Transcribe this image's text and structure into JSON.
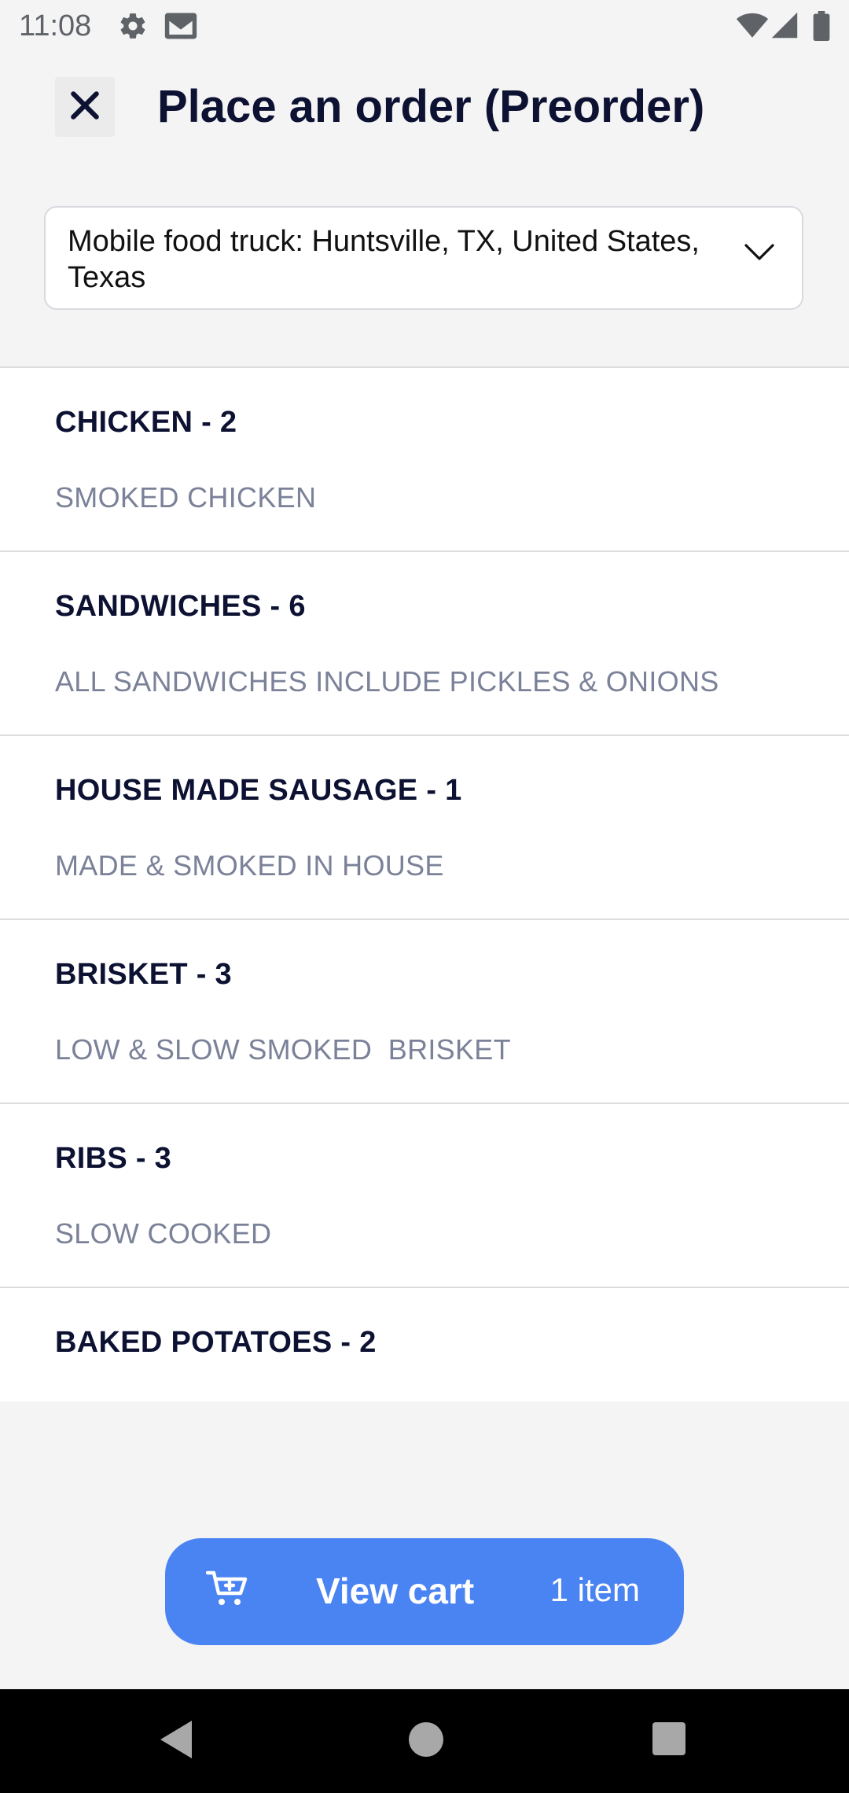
{
  "status_bar": {
    "time": "11:08",
    "icons": [
      "settings-icon",
      "gmail-icon",
      "wifi-icon",
      "signal-icon",
      "battery-icon"
    ]
  },
  "header": {
    "close_icon": "close-icon",
    "title": "Place an order (Preorder)"
  },
  "location": {
    "value": "Mobile food truck: Huntsville, TX, United States, Texas",
    "icon": "chevron-down-icon"
  },
  "categories": [
    {
      "title": "CHICKEN - 2",
      "description": "SMOKED CHICKEN"
    },
    {
      "title": "SANDWICHES - 6",
      "description": "ALL SANDWICHES INCLUDE PICKLES & ONIONS"
    },
    {
      "title": "HOUSE MADE SAUSAGE - 1",
      "description": "MADE & SMOKED IN HOUSE"
    },
    {
      "title": "BRISKET - 3",
      "description": "LOW & SLOW SMOKED  BRISKET"
    },
    {
      "title": "RIBS - 3",
      "description": "SLOW COOKED"
    },
    {
      "title": "BAKED POTATOES - 2"
    }
  ],
  "cart": {
    "icon": "cart-icon",
    "label": "View cart",
    "count": "1 item",
    "color": "#4a83f2"
  },
  "nav_bar": {
    "icons": [
      "back-icon",
      "home-icon",
      "recents-icon"
    ]
  }
}
